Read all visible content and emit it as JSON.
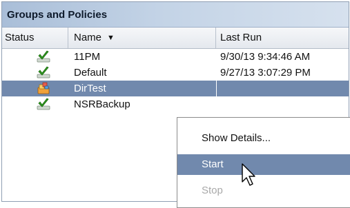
{
  "panel": {
    "title": "Groups and Policies"
  },
  "columns": {
    "status": "Status",
    "name": "Name",
    "last_run": "Last Run"
  },
  "rows": [
    {
      "status_icon": "check-icon",
      "name": "11PM",
      "last_run": "9/30/13 9:34:46 AM",
      "selected": false
    },
    {
      "status_icon": "check-icon",
      "name": "Default",
      "last_run": "9/27/13 3:07:29 PM",
      "selected": false
    },
    {
      "status_icon": "running-boxes-icon",
      "name": "DirTest",
      "last_run": "",
      "selected": true
    },
    {
      "status_icon": "check-icon",
      "name": "NSRBackup",
      "last_run": "",
      "selected": false
    }
  ],
  "context_menu": {
    "items": [
      {
        "label": "Show Details...",
        "state": "normal"
      },
      {
        "label": "Start",
        "state": "highlighted"
      },
      {
        "label": "Stop",
        "state": "disabled"
      }
    ]
  },
  "colors": {
    "selection": "#7189ad",
    "check": "#2f9a1e",
    "header_gradient_start": "#a9bed8"
  }
}
